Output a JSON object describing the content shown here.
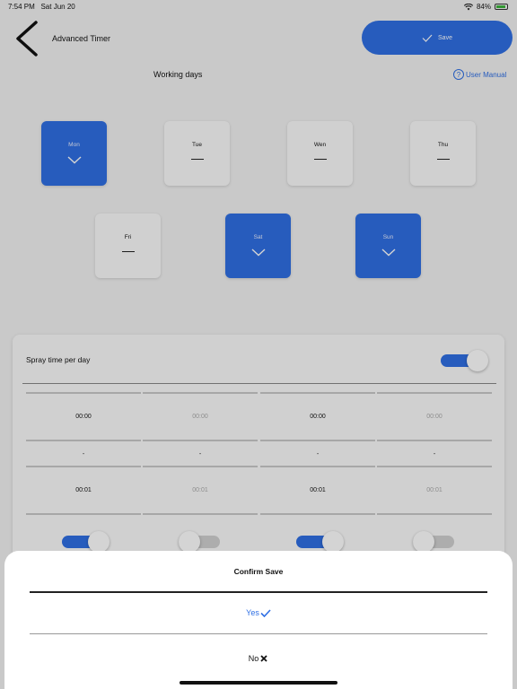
{
  "status_bar": {
    "time": "7:54 PM",
    "date": "Sat Jun 20",
    "battery": "84%"
  },
  "header": {
    "title": "Advanced Timer",
    "save_label": "Save",
    "help_label": "User Manual",
    "help_icon": "?"
  },
  "working_days": {
    "title": "Working days",
    "days": [
      {
        "label": "Mon",
        "selected": true
      },
      {
        "label": "Tue",
        "selected": false
      },
      {
        "label": "Wen",
        "selected": false
      },
      {
        "label": "Thu",
        "selected": false
      },
      {
        "label": "Fri",
        "selected": false
      },
      {
        "label": "Sat",
        "selected": true
      },
      {
        "label": "Sun",
        "selected": true
      }
    ]
  },
  "spray": {
    "label": "Spray time per day",
    "enabled": true,
    "slots": [
      {
        "start": "00:00",
        "sep": "-",
        "end": "00:01",
        "enabled": true
      },
      {
        "start": "00:00",
        "sep": "-",
        "end": "00:01",
        "enabled": false
      },
      {
        "start": "00:00",
        "sep": "-",
        "end": "00:01",
        "enabled": true
      },
      {
        "start": "00:00",
        "sep": "-",
        "end": "00:01",
        "enabled": false
      }
    ]
  },
  "dialog": {
    "title": "Confirm Save",
    "yes_label": "Yes",
    "no_label": "No",
    "accent": "#2f6fe4"
  }
}
